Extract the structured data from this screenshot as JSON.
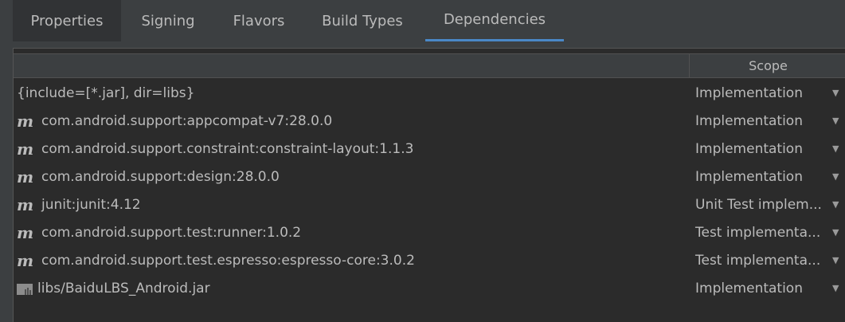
{
  "tabs": [
    {
      "label": "Properties"
    },
    {
      "label": "Signing"
    },
    {
      "label": "Flavors"
    },
    {
      "label": "Build Types"
    },
    {
      "label": "Dependencies"
    }
  ],
  "table": {
    "scope_header": "Scope",
    "rows": [
      {
        "name": "{include=[*.jar], dir=libs}",
        "icon": "none",
        "scope": "Implementation"
      },
      {
        "name": "com.android.support:appcompat-v7:28.0.0",
        "icon": "maven-icon",
        "scope": "Implementation"
      },
      {
        "name": "com.android.support.constraint:constraint-layout:1.1.3",
        "icon": "maven-icon",
        "scope": "Implementation"
      },
      {
        "name": "com.android.support:design:28.0.0",
        "icon": "maven-icon",
        "scope": "Implementation"
      },
      {
        "name": "junit:junit:4.12",
        "icon": "maven-icon",
        "scope": "Unit Test implem..."
      },
      {
        "name": "com.android.support.test:runner:1.0.2",
        "icon": "maven-icon",
        "scope": "Test implementa..."
      },
      {
        "name": "com.android.support.test.espresso:espresso-core:3.0.2",
        "icon": "maven-icon",
        "scope": "Test implementa..."
      },
      {
        "name": "libs/BaiduLBS_Android.jar",
        "icon": "jar-library-icon",
        "scope": "Implementation"
      }
    ],
    "maven_glyph": "m"
  },
  "colors": {
    "background": "#3c3f41",
    "table_background": "#2b2b2b",
    "text": "#bbbbbb",
    "active_tab_underline": "#4a88c7"
  }
}
